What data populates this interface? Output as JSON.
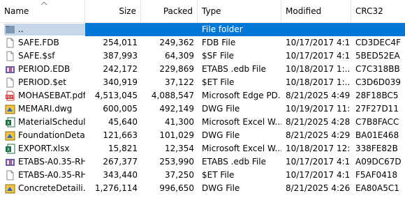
{
  "columns": {
    "name": "Name",
    "size": "Size",
    "packed": "Packed",
    "type": "Type",
    "modified": "Modified",
    "crc": "CRC32"
  },
  "rows": [
    {
      "name": "..",
      "size": "",
      "packed": "",
      "type": "File folder",
      "modified": "",
      "crc": "",
      "icon": "folder-up-icon",
      "selected": true
    },
    {
      "name": "SAFE.FDB",
      "size": "254,011",
      "packed": "249,362",
      "type": "FDB File",
      "modified": "10/17/2017 4:1...",
      "crc": "CD3DEC4F",
      "icon": "blank-file-icon"
    },
    {
      "name": "SAFE.$sf",
      "size": "387,993",
      "packed": "64,309",
      "type": "$SF File",
      "modified": "10/17/2017 4:1...",
      "crc": "5BED52EA",
      "icon": "blank-file-icon"
    },
    {
      "name": "PERIOD.EDB",
      "size": "242,172",
      "packed": "229,869",
      "type": "ETABS .edb File",
      "modified": "10/18/2017 1:...",
      "crc": "C7C318BB",
      "icon": "etabs-file-icon"
    },
    {
      "name": "PERIOD.$et",
      "size": "340,919",
      "packed": "37,122",
      "type": "$ET File",
      "modified": "10/18/2017 1:...",
      "crc": "C3D6D039",
      "icon": "blank-file-icon"
    },
    {
      "name": "MOHASEBAT.pdf",
      "size": "4,513,045",
      "packed": "4,088,547",
      "type": "Microsoft Edge PD...",
      "modified": "8/21/2025 4:49 ...",
      "crc": "28F18BC5",
      "icon": "pdf-file-icon"
    },
    {
      "name": "MEMARI.dwg",
      "size": "600,005",
      "packed": "492,149",
      "type": "DWG File",
      "modified": "10/19/2017 11:...",
      "crc": "27F27D11",
      "icon": "dwg-file-icon"
    },
    {
      "name": "MaterialSchedul...",
      "size": "45,640",
      "packed": "41,300",
      "type": "Microsoft Excel W...",
      "modified": "8/21/2025 4:28 ...",
      "crc": "C7B8FACC",
      "icon": "excel-file-icon"
    },
    {
      "name": "FoundationDeta...",
      "size": "121,663",
      "packed": "101,029",
      "type": "DWG File",
      "modified": "8/21/2025 4:29 ...",
      "crc": "BA01E468",
      "icon": "dwg-file-icon"
    },
    {
      "name": "EXPORT.xlsx",
      "size": "15,821",
      "packed": "12,354",
      "type": "Microsoft Excel W...",
      "modified": "10/18/2017 12:...",
      "crc": "338FE82B",
      "icon": "excel-file-icon"
    },
    {
      "name": "ETABS-A0.35-RH...",
      "size": "267,377",
      "packed": "253,990",
      "type": "ETABS .edb File",
      "modified": "10/17/2017 4:1...",
      "crc": "A09DC67D",
      "icon": "etabs-file-icon"
    },
    {
      "name": "ETABS-A0.35-RH...",
      "size": "343,440",
      "packed": "37,250",
      "type": "$ET File",
      "modified": "10/17/2017 4:1...",
      "crc": "F5AF0418",
      "icon": "blank-file-icon"
    },
    {
      "name": "ConcreteDetaili...",
      "size": "1,276,114",
      "packed": "996,650",
      "type": "DWG File",
      "modified": "8/21/2025 4:26 ...",
      "crc": "EA80A5C1",
      "icon": "dwg-file-icon"
    }
  ],
  "colors": {
    "selection": "#0078d7",
    "selection_name_bg": "#c8d8ea",
    "header_border": "#e5e5e5"
  }
}
